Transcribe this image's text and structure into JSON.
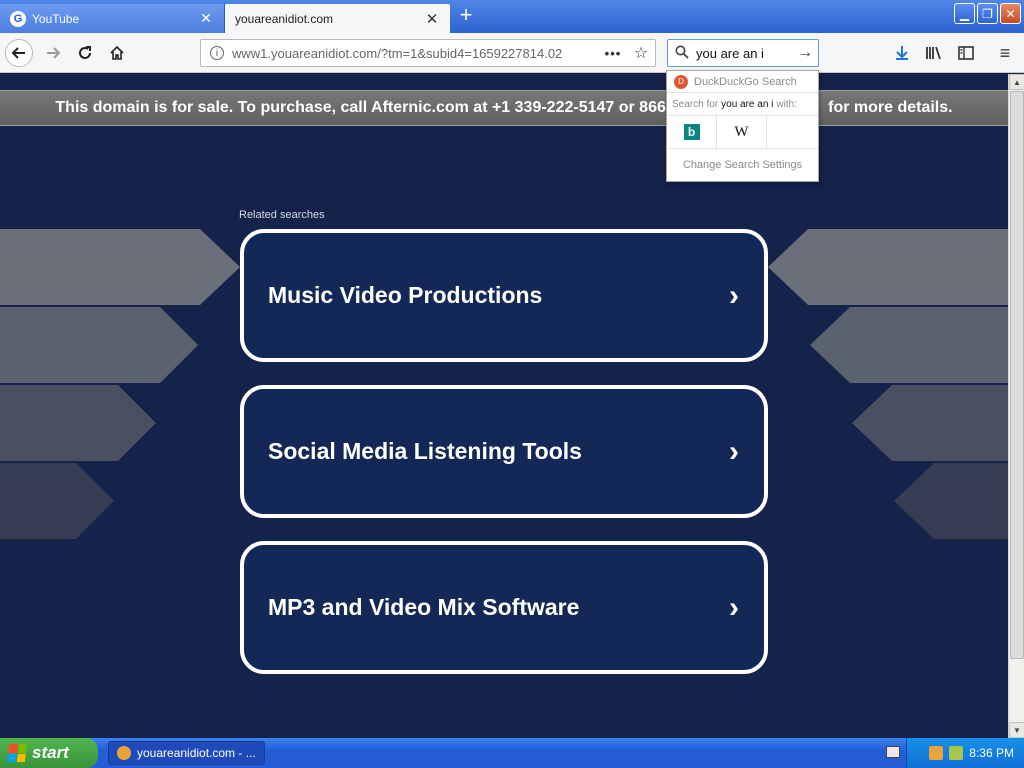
{
  "browser": {
    "tabs": [
      {
        "title": "YouTube",
        "active": false
      },
      {
        "title": "youareanidiot.com",
        "active": true
      }
    ],
    "url": "www1.youareanidiot.com/?tm=1&subid4=1659227814.02",
    "search_query": "you are an i"
  },
  "page": {
    "banner_text": "This domain is for sale. To purchase, call Afternic.com at +1 339-222-5147 or 866-",
    "banner_tail": "for more details.",
    "related_heading": "Related searches",
    "related_items": [
      {
        "label": "Music Video Productions"
      },
      {
        "label": "Social Media Listening Tools"
      },
      {
        "label": "MP3 and Video Mix Software"
      }
    ]
  },
  "search_popup": {
    "engine_name": "DuckDuckGo Search",
    "search_for_prefix": "Search for",
    "search_query": "you are an i",
    "search_for_suffix": "with:",
    "engines": [
      {
        "name": "bing-icon"
      },
      {
        "name": "wikipedia-icon"
      }
    ],
    "settings_label": "Change Search Settings"
  },
  "taskbar": {
    "start_label": "start",
    "task_item": "youareanidiot.com - ...",
    "clock": "8:36 PM"
  },
  "colors": {
    "page_bg": "#15224a",
    "box_bg": "#142857",
    "banner_bg": "#6b6d6b",
    "titlebar": "#2e63cf",
    "taskbar": "#245dd6",
    "start_green": "#3b943b"
  }
}
